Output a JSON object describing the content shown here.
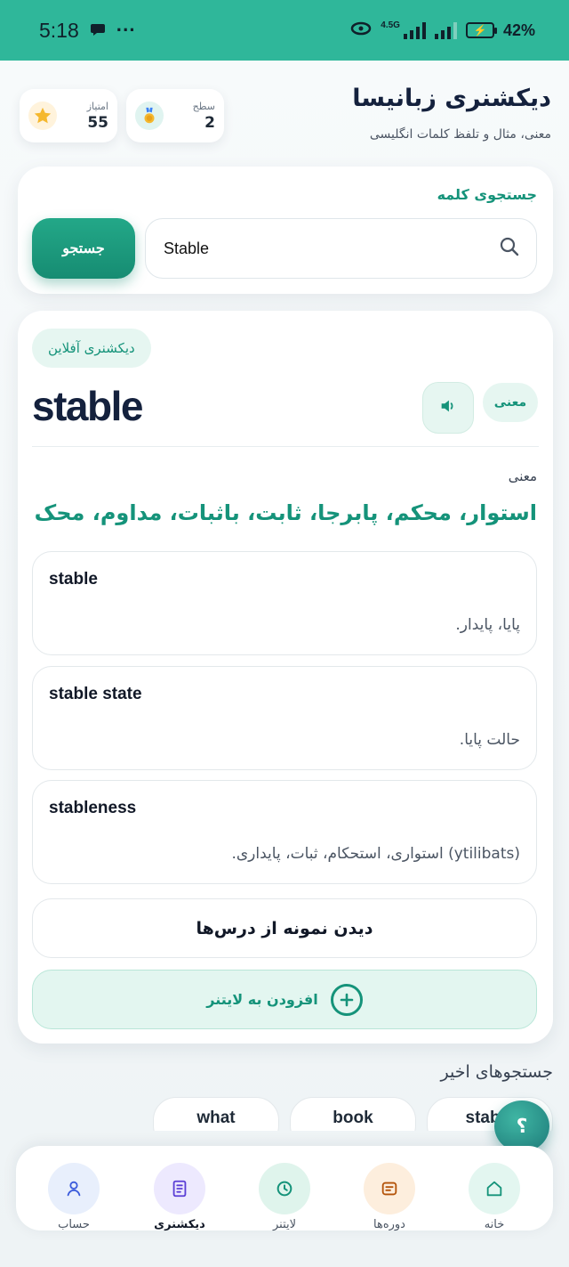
{
  "status_bar": {
    "time": "5:18",
    "dots": "···",
    "network": "4.5G",
    "battery": "42%"
  },
  "header": {
    "title": "دیکشنری زبانیسا",
    "subtitle": "معنی، مثال و تلفظ کلمات انگلیسی",
    "level": {
      "label": "سطح",
      "value": "2"
    },
    "points": {
      "label": "امتیاز",
      "value": "55"
    }
  },
  "search": {
    "label": "جستجوی کلمه",
    "value": "Stable",
    "button": "جستجو"
  },
  "result": {
    "badge": "دیکشنری آفلاین",
    "headword": "stable",
    "meaning_tag": "معنی",
    "meaning_label": "معنی",
    "meaning": "استوار، محکم، پابرجا، ثابت، باثبات، مداوم، محک",
    "entries": [
      {
        "en": "stable",
        "fa": "پایا، پایدار."
      },
      {
        "en": "stable state",
        "fa": "حالت پایا."
      },
      {
        "en": "stableness",
        "fa": "(ytilibats) استواری، استحکام، ثبات، پایداری."
      }
    ],
    "examples_button": "دیدن نمونه از درس‌ها",
    "leitner_button": "افزودن به لایتنر"
  },
  "recent": {
    "title": "جستجوهای اخیر",
    "items": [
      "what",
      "book",
      "stable"
    ]
  },
  "help_fab": "؟",
  "nav": [
    {
      "label": "حساب",
      "icon": "user-icon"
    },
    {
      "label": "دیکشنری",
      "icon": "book-icon"
    },
    {
      "label": "لایتنر",
      "icon": "clock-icon"
    },
    {
      "label": "دوره‌ها",
      "icon": "course-icon"
    },
    {
      "label": "خانه",
      "icon": "home-icon"
    }
  ],
  "colors": {
    "status_bar": "#2fb79a",
    "accent": "#15937a",
    "text_dark": "#14213d"
  }
}
